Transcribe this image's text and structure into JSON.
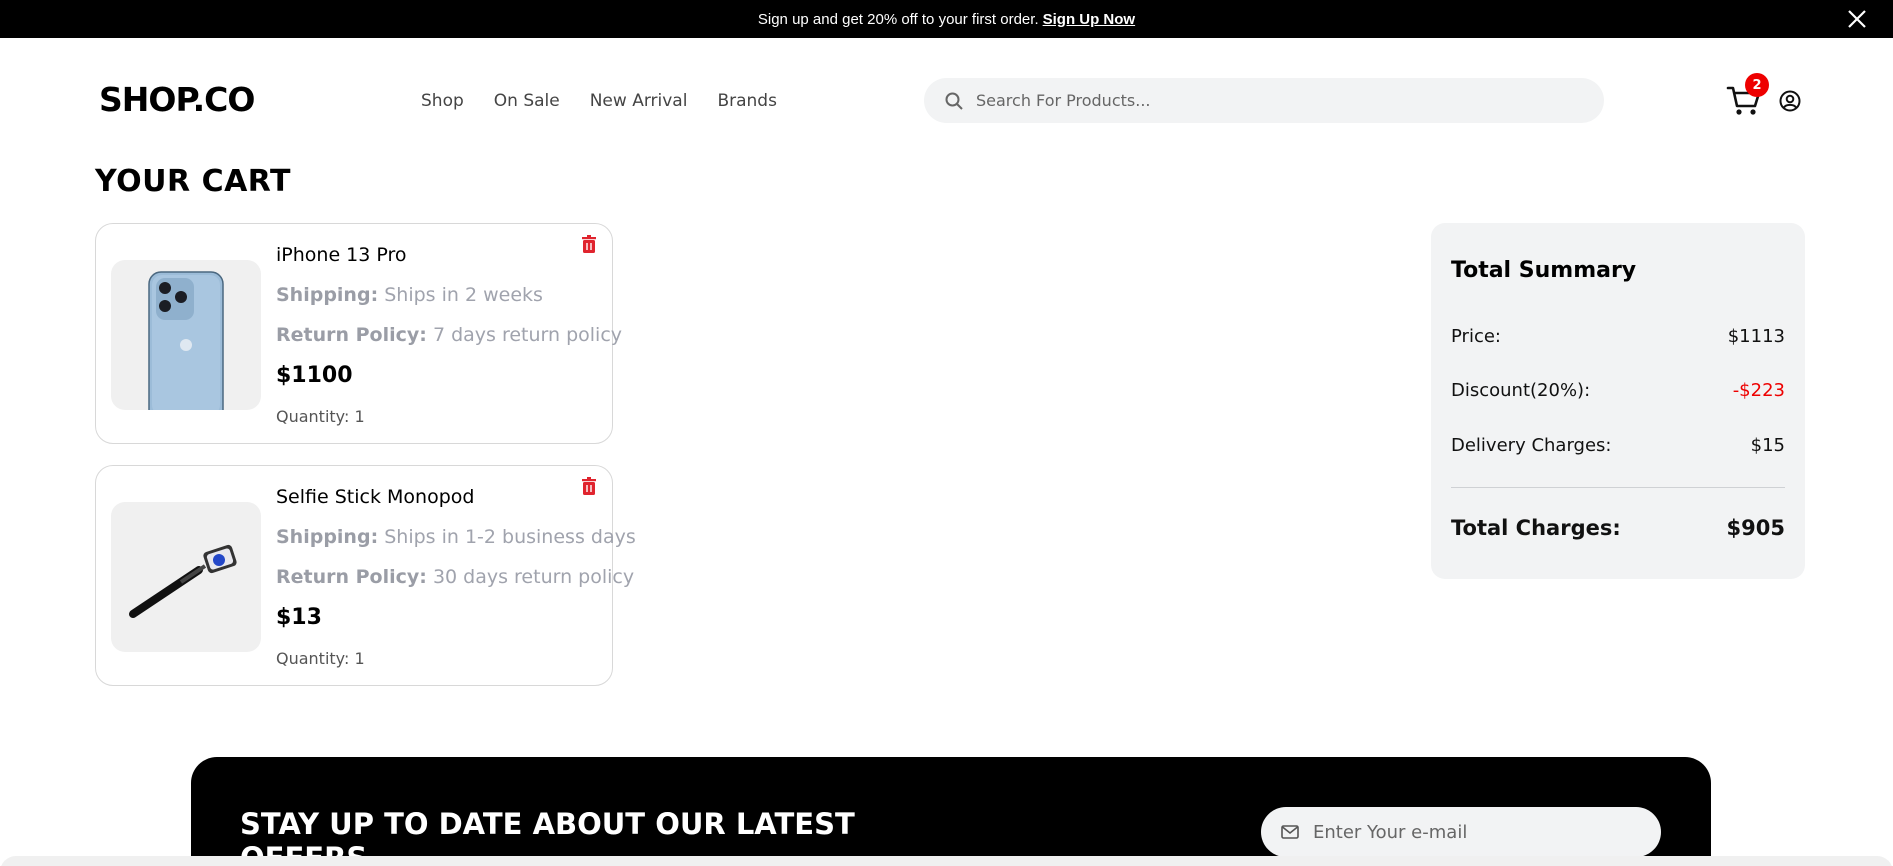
{
  "banner": {
    "text": "Sign up and get 20% off to your first order.",
    "link": "Sign Up Now"
  },
  "header": {
    "logo": "SHOP.CO",
    "nav": [
      "Shop",
      "On Sale",
      "New Arrival",
      "Brands"
    ],
    "search_placeholder": "Search For Products...",
    "cart_count": "2"
  },
  "cart": {
    "title": "YOUR CART",
    "shipping_label": "Shipping:",
    "return_label": "Return Policy:",
    "items": [
      {
        "name": "iPhone 13 Pro",
        "shipping": "Ships in 2 weeks",
        "return_policy": "7 days return policy",
        "price": "$1100",
        "quantity": "Quantity: 1"
      },
      {
        "name": "Selfie Stick Monopod",
        "shipping": "Ships in 1-2 business days",
        "return_policy": "30 days return policy",
        "price": "$13",
        "quantity": "Quantity: 1"
      }
    ]
  },
  "summary": {
    "title": "Total Summary",
    "price_label": "Price:",
    "price_value": "$1113",
    "discount_label": "Discount(20%):",
    "discount_value": "-$223",
    "delivery_label": "Delivery Charges:",
    "delivery_value": "$15",
    "total_label": "Total Charges:",
    "total_value": "$905"
  },
  "newsletter": {
    "title": "STAY UP TO DATE ABOUT OUR LATEST OFFERS",
    "email_placeholder": "Enter Your e-mail"
  },
  "colors": {
    "accent_red": "#e00000",
    "banner_bg": "#000000"
  },
  "icons": [
    "close-icon",
    "search-icon",
    "cart-icon",
    "user-icon",
    "trash-icon",
    "mail-icon"
  ]
}
